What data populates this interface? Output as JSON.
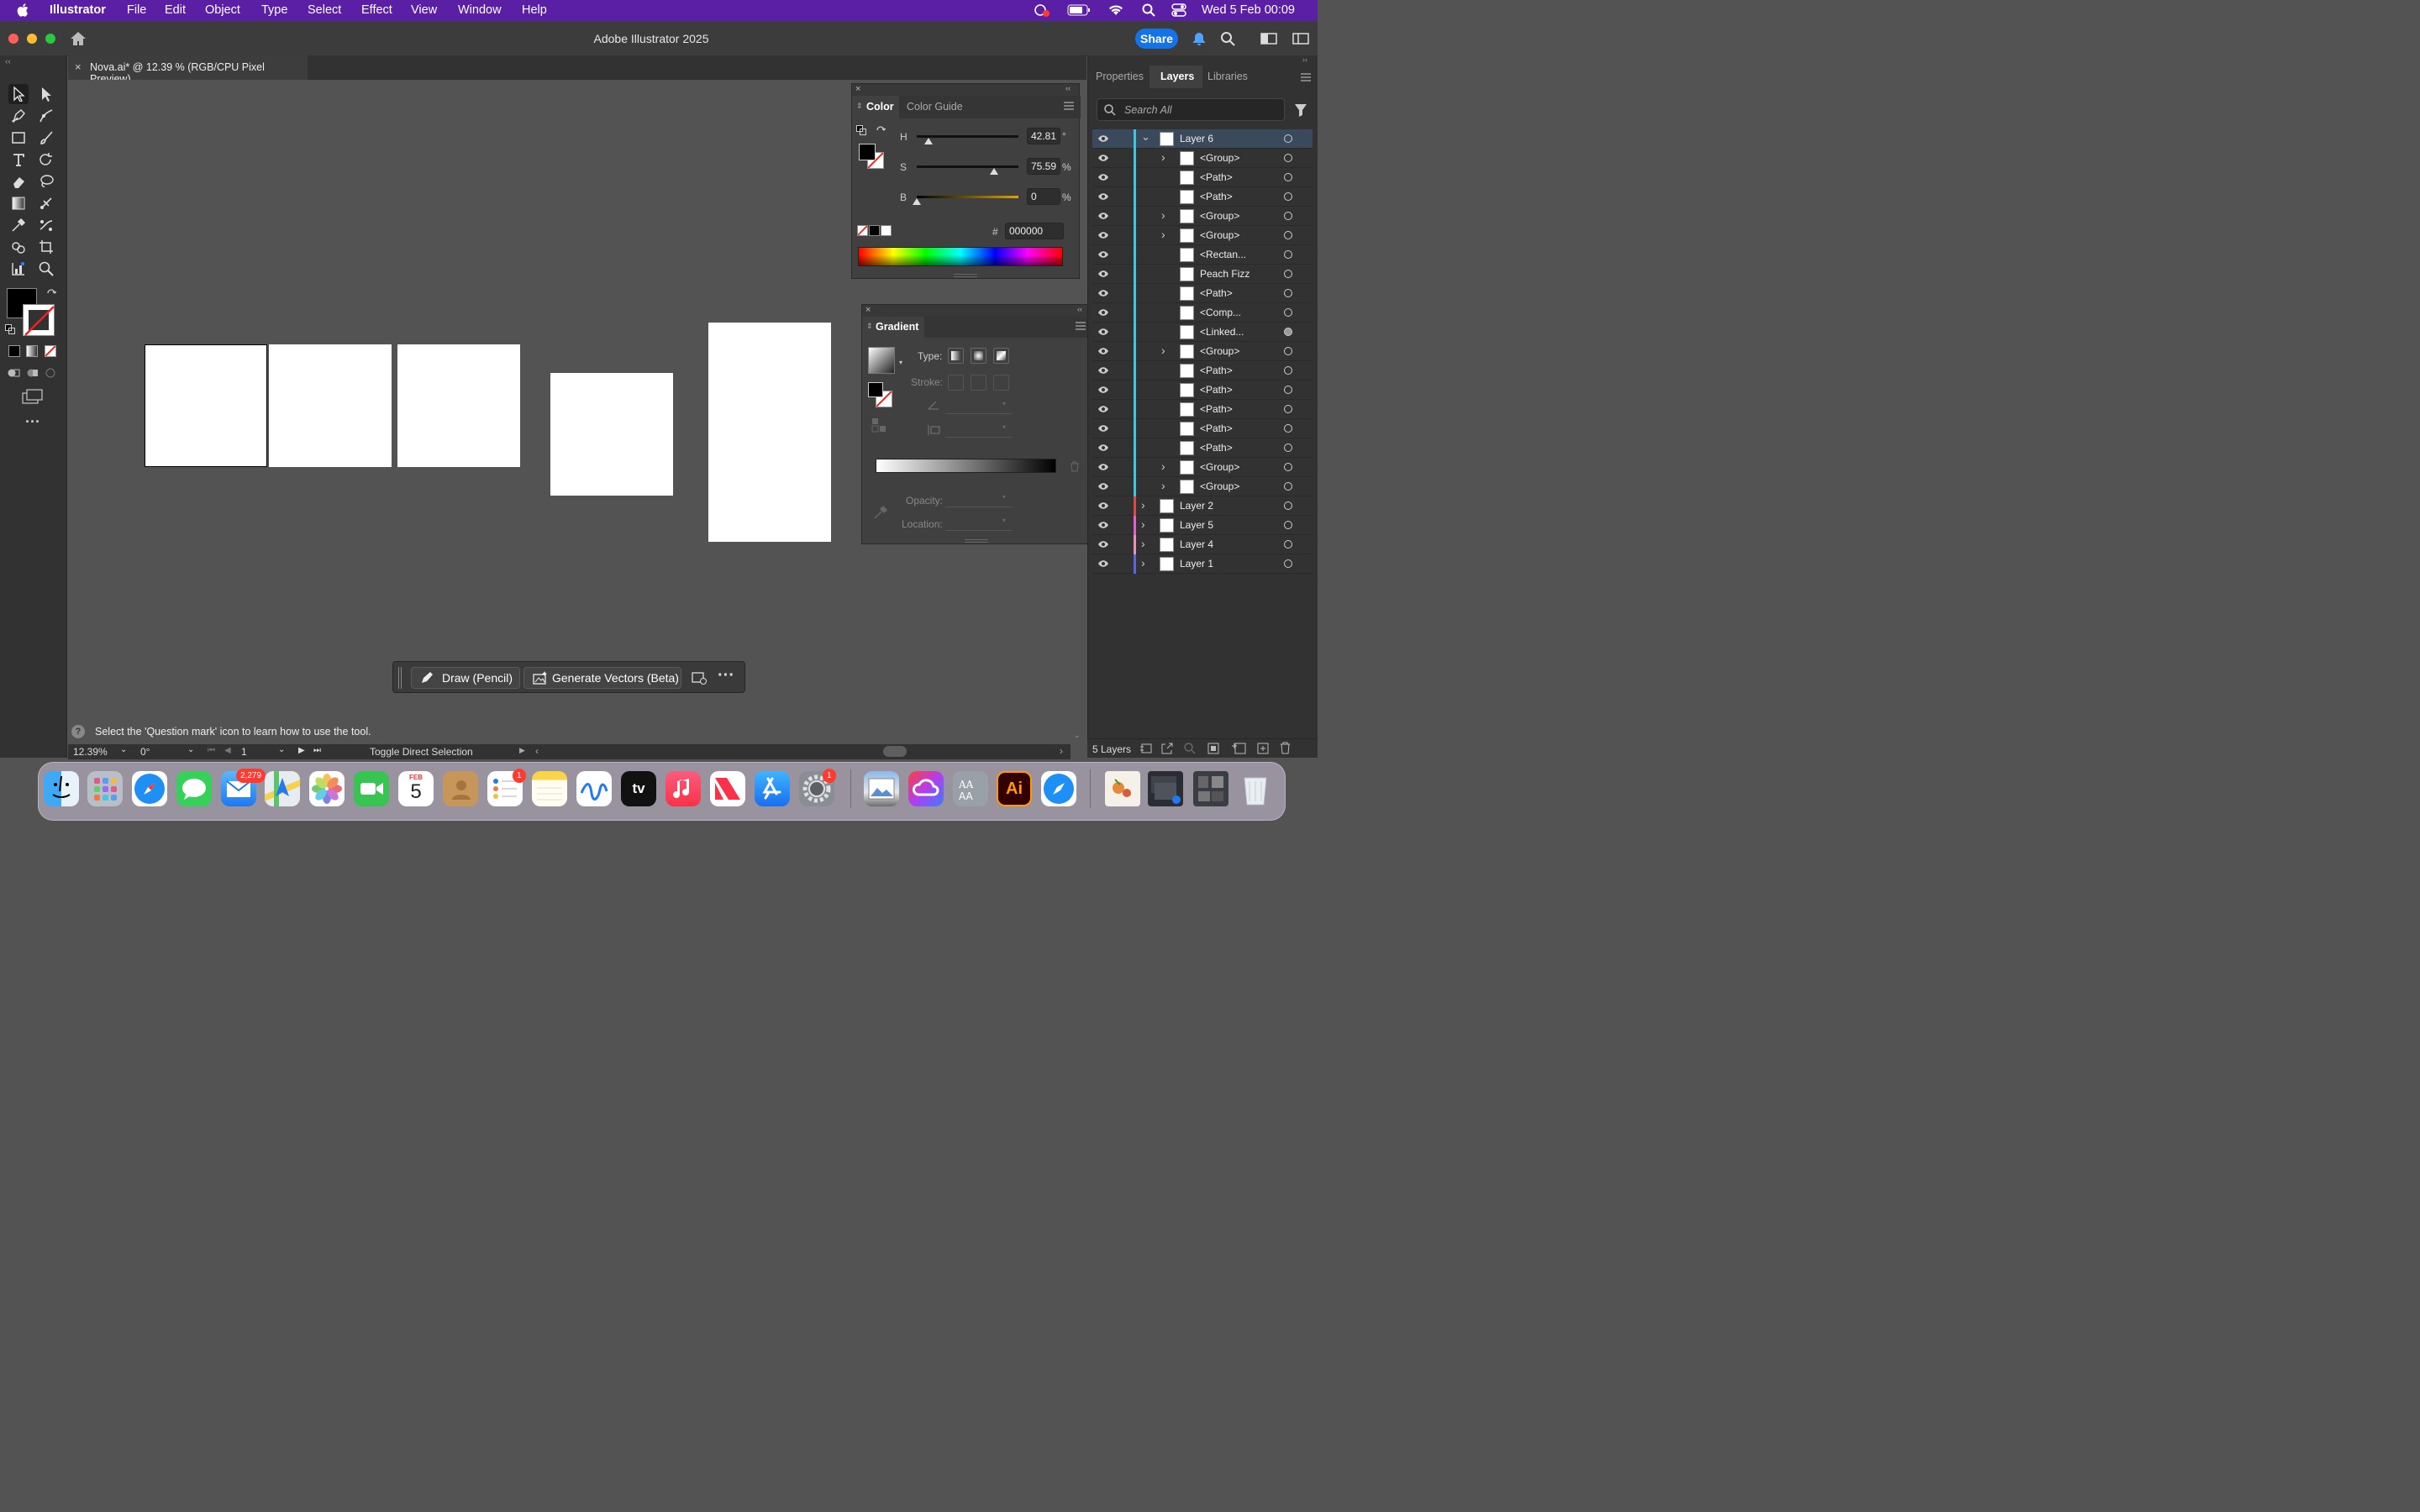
{
  "menubar": {
    "app": "Illustrator",
    "items": [
      "File",
      "Edit",
      "Object",
      "Type",
      "Select",
      "Effect",
      "View",
      "Window",
      "Help"
    ],
    "datetime": "Wed 5 Feb  00:09"
  },
  "window": {
    "title": "Adobe Illustrator 2025",
    "share_label": "Share"
  },
  "doc_tab": {
    "label": "Nova.ai* @ 12.39 % (RGB/CPU Pixel Preview)"
  },
  "color_panel": {
    "tabs": [
      "Color",
      "Color Guide"
    ],
    "h_label": "H",
    "h_value": "42.81",
    "h_unit": "°",
    "s_label": "S",
    "s_value": "75.59",
    "s_unit": "%",
    "b_label": "B",
    "b_value": "0",
    "b_unit": "%",
    "hex_label": "#",
    "hex_value": "000000"
  },
  "gradient_panel": {
    "title": "Gradient",
    "type_label": "Type:",
    "stroke_label": "Stroke:",
    "opacity_label": "Opacity:",
    "location_label": "Location:"
  },
  "right_dock": {
    "tabs": [
      "Properties",
      "Layers",
      "Libraries"
    ],
    "search_placeholder": "Search All",
    "footer_count": "5 Layers"
  },
  "layers": [
    {
      "name": "Layer 6",
      "level": 0,
      "expand": "open",
      "color": "#3fc5e0"
    },
    {
      "name": "<Group>",
      "level": 1,
      "expand": "closed",
      "color": "#3fc5e0"
    },
    {
      "name": "<Path>",
      "level": 1,
      "expand": "none",
      "color": "#3fc5e0"
    },
    {
      "name": "<Path>",
      "level": 1,
      "expand": "none",
      "color": "#3fc5e0"
    },
    {
      "name": "<Group>",
      "level": 1,
      "expand": "closed",
      "color": "#3fc5e0"
    },
    {
      "name": "<Group>",
      "level": 1,
      "expand": "closed",
      "color": "#3fc5e0"
    },
    {
      "name": "<Rectan...",
      "level": 1,
      "expand": "none",
      "color": "#3fc5e0"
    },
    {
      "name": "Peach Fizz",
      "level": 1,
      "expand": "none",
      "color": "#3fc5e0"
    },
    {
      "name": "<Path>",
      "level": 1,
      "expand": "none",
      "color": "#3fc5e0"
    },
    {
      "name": "<Comp...",
      "level": 1,
      "expand": "none",
      "color": "#3fc5e0"
    },
    {
      "name": "<Linked...",
      "level": 1,
      "expand": "none",
      "color": "#3fc5e0"
    },
    {
      "name": "<Group>",
      "level": 1,
      "expand": "closed",
      "color": "#3fc5e0"
    },
    {
      "name": "<Path>",
      "level": 1,
      "expand": "none",
      "color": "#3fc5e0"
    },
    {
      "name": "<Path>",
      "level": 1,
      "expand": "none",
      "color": "#3fc5e0"
    },
    {
      "name": "<Path>",
      "level": 1,
      "expand": "none",
      "color": "#3fc5e0"
    },
    {
      "name": "<Path>",
      "level": 1,
      "expand": "none",
      "color": "#3fc5e0"
    },
    {
      "name": "<Path>",
      "level": 1,
      "expand": "none",
      "color": "#3fc5e0"
    },
    {
      "name": "<Group>",
      "level": 1,
      "expand": "closed",
      "color": "#3fc5e0"
    },
    {
      "name": "<Group>",
      "level": 1,
      "expand": "closed",
      "color": "#3fc5e0"
    },
    {
      "name": "Layer 2",
      "level": 0,
      "expand": "closed",
      "color": "#e04848"
    },
    {
      "name": "Layer 5",
      "level": 0,
      "expand": "closed",
      "color": "#e060d0"
    },
    {
      "name": "Layer 4",
      "level": 0,
      "expand": "closed",
      "color": "#e890b8"
    },
    {
      "name": "Layer 1",
      "level": 0,
      "expand": "closed",
      "color": "#5a66e0"
    }
  ],
  "context_bar": {
    "draw_label": "Draw (Pencil)",
    "generate_label": "Generate Vectors (Beta)"
  },
  "status": {
    "hint": "Select the 'Question mark' icon to learn how to use the tool.",
    "zoom": "12.39%",
    "rotation": "0°",
    "artboard": "1",
    "tool_status": "Toggle Direct Selection"
  },
  "dock": {
    "mail_badge": "2,279",
    "reminders_badge": "1",
    "settings_badge": "1",
    "calendar_month": "FEB",
    "calendar_day": "5",
    "tv_label": "tv",
    "ai_label": "Ai"
  },
  "colors": {
    "menubar": "#5b1fa6",
    "accent": "#1473e6",
    "layer6_bar": "#3fc5e0"
  }
}
